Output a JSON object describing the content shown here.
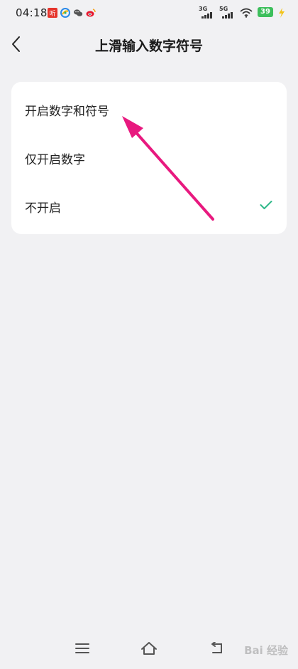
{
  "status_bar": {
    "time": "04:18",
    "app_icons": [
      "news-app-icon",
      "qq-browser-icon",
      "wechat-icon",
      "weibo-icon"
    ],
    "network_1": "3G",
    "network_2": "5G",
    "battery_level": "39",
    "charging": true
  },
  "header": {
    "title": "上滑输入数字符号",
    "back_icon": "chevron-left-icon"
  },
  "options": {
    "items": [
      {
        "label": "开启数字和符号",
        "selected": false
      },
      {
        "label": "仅开启数字",
        "selected": false
      },
      {
        "label": "不开启",
        "selected": true
      }
    ],
    "check_color": "#2fb889"
  },
  "annotation": {
    "arrow_color": "#e8197f"
  },
  "nav_bar": {
    "icons": [
      "menu-icon",
      "home-icon",
      "back-icon"
    ]
  },
  "watermark": "Bai 经验"
}
